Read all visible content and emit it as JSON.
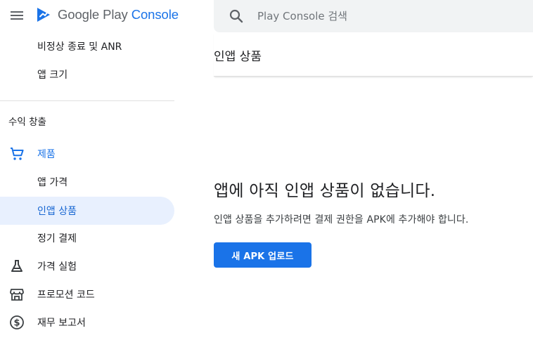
{
  "brand": {
    "name_main": "Google Play ",
    "name_accent": "Console",
    "accent_color": "#1a73e8",
    "menu_icon": "hamburger-menu-icon",
    "logo_icon": "play-console-logo-icon"
  },
  "sidebar": {
    "top_items": [
      {
        "label": "비정상 종료 및 ANR"
      },
      {
        "label": "앱 크기"
      }
    ],
    "section_title": "수익 창출",
    "items": [
      {
        "label": "제품",
        "icon": "shopping-cart-icon"
      },
      {
        "label": "앱 가격"
      },
      {
        "label": "인앱 상품"
      },
      {
        "label": "정기 결제"
      },
      {
        "label": "가격 실험",
        "icon": "flask-icon"
      },
      {
        "label": "프로모션 코드",
        "icon": "storefront-icon"
      },
      {
        "label": "재무 보고서",
        "icon": "dollar-circle-icon"
      }
    ],
    "selected_color": "#e8f0fe"
  },
  "search": {
    "placeholder": "Play Console 검색",
    "value": "",
    "icon": "search-icon"
  },
  "page": {
    "title": "인앱 상품"
  },
  "empty_state": {
    "heading": "앱에 아직 인앱 상품이 없습니다.",
    "description": "인앱 상품을 추가하려면 결제 권한을 APK에 추가해야 합니다.",
    "button_label": "새 APK 업로드",
    "button_color": "#1a73e8"
  }
}
